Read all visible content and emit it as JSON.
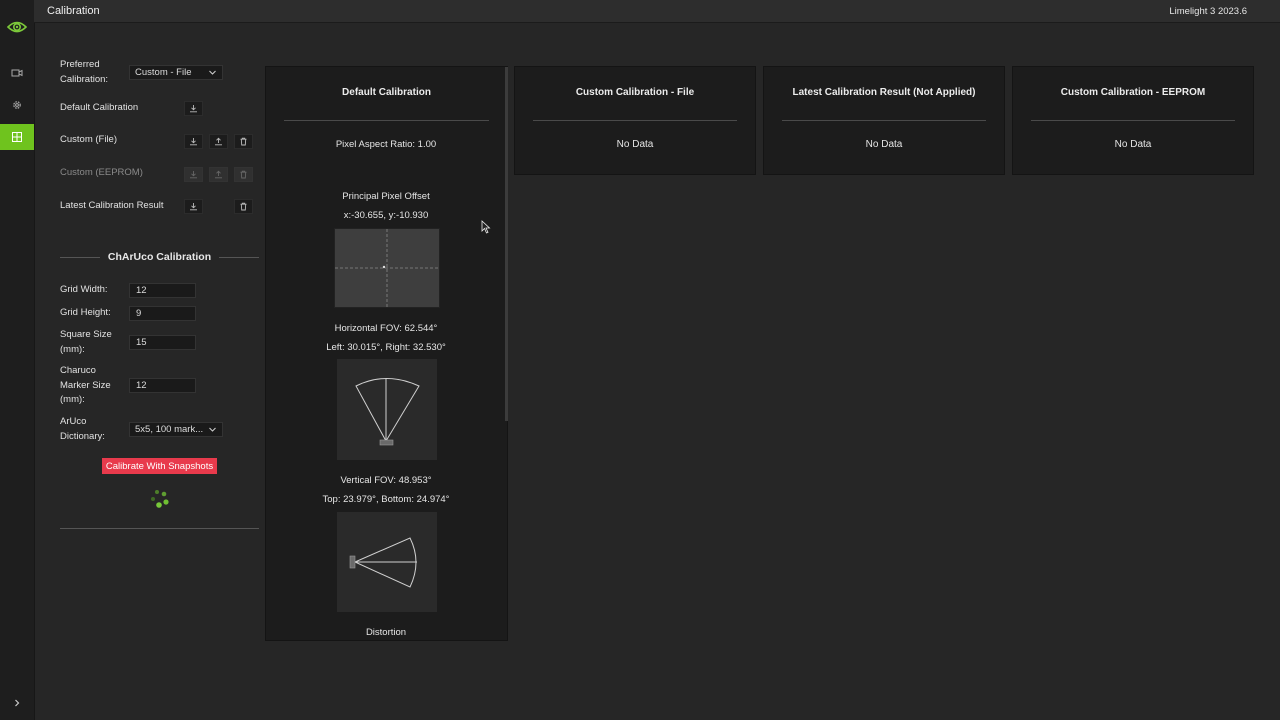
{
  "app": {
    "title": "Calibration",
    "version": "Limelight 3 2023.6"
  },
  "rail": {
    "items": [
      {
        "icon": "limelight-logo-icon",
        "active": false
      },
      {
        "icon": "camera-icon",
        "active": false
      },
      {
        "icon": "gear-icon",
        "active": false
      },
      {
        "icon": "calibration-icon",
        "active": true
      }
    ],
    "expand_icon": "chevron-right-icon"
  },
  "sources": {
    "preferred_label_1": "Preferred",
    "preferred_label_2": "Calibration:",
    "preferred_value": "Custom - File",
    "rows": [
      {
        "label": "Default Calibration",
        "enabled": true,
        "actions": [
          "download"
        ]
      },
      {
        "label": "Custom (File)",
        "enabled": true,
        "actions": [
          "download",
          "upload",
          "delete"
        ]
      },
      {
        "label": "Custom (EEPROM)",
        "enabled": false,
        "actions": [
          "download",
          "upload",
          "delete"
        ]
      },
      {
        "label": "Latest Calibration Result",
        "enabled": true,
        "actions": [
          "download",
          "delete"
        ]
      }
    ]
  },
  "charuco": {
    "title": "ChArUco Calibration",
    "grid_width_label": "Grid Width:",
    "grid_width": "12",
    "grid_height_label": "Grid Height:",
    "grid_height": "9",
    "square_size_label_1": "Square Size",
    "square_size_label_2": "(mm):",
    "square_size": "15",
    "marker_size_label_1": "Charuco",
    "marker_size_label_2": "Marker Size",
    "marker_size_label_3": "(mm):",
    "marker_size": "12",
    "dictionary_label_1": "ArUco",
    "dictionary_label_2": "Dictionary:",
    "dictionary_value": "5x5, 100 mark...",
    "calibrate_button": "Calibrate With Snapshots"
  },
  "cards": {
    "default": {
      "title": "Default Calibration",
      "pixel_aspect_ratio": "Pixel Aspect Ratio: 1.00",
      "principal_offset_title": "Principal Pixel Offset",
      "principal_offset_value": "x:-30.655, y:-10.930",
      "hfov": "Horizontal FOV: 62.544°",
      "hfov_split": "Left: 30.015°, Right: 32.530°",
      "vfov": "Vertical FOV: 48.953°",
      "vfov_split": "Top: 23.979°, Bottom: 24.974°",
      "distortion": "Distortion"
    },
    "custom_file": {
      "title": "Custom Calibration - File",
      "status": "No Data"
    },
    "latest": {
      "title": "Latest Calibration Result (Not Applied)",
      "status": "No Data"
    },
    "eeprom": {
      "title": "Custom Calibration - EEPROM",
      "status": "No Data"
    }
  },
  "colors": {
    "accent": "#6fc31e",
    "danger": "#e83a4c",
    "background": "#262626",
    "card": "#1c1c1c"
  }
}
